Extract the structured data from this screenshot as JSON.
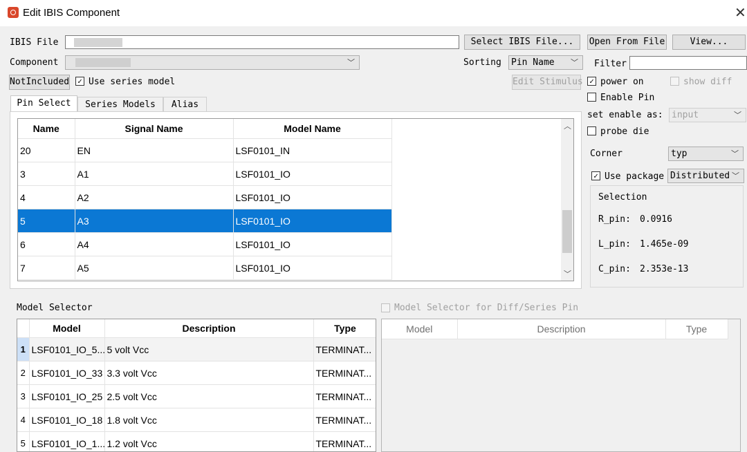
{
  "window": {
    "title": "Edit IBIS Component",
    "close_glyph": "✕"
  },
  "ibis_file": {
    "label": "IBIS File",
    "value": "",
    "select_button": "Select IBIS File...",
    "open_button": "Open From File",
    "view_button": "View..."
  },
  "component": {
    "label": "Component",
    "value": ""
  },
  "sorting": {
    "label": "Sorting",
    "value": "Pin Name"
  },
  "filter": {
    "label": "Filter",
    "value": ""
  },
  "not_included_button": "NotIncluded",
  "use_series_model": {
    "label": "Use series model",
    "checked": true
  },
  "edit_stimulus_button": "Edit Stimulus",
  "power_on": {
    "label": "power on",
    "checked": true
  },
  "show_diff": {
    "label": "show diff",
    "checked": false
  },
  "enable_pin": {
    "label": "Enable Pin",
    "checked": false
  },
  "set_enable_as": {
    "label": "set enable as:",
    "value": "input"
  },
  "probe_die": {
    "label": "probe die",
    "checked": false
  },
  "corner": {
    "label": "Corner",
    "value": "typ"
  },
  "use_package": {
    "label": "Use package",
    "checked": true,
    "value": "Distributed"
  },
  "selection": {
    "title": "Selection",
    "r_pin": {
      "label": "R_pin:",
      "value": "0.0916"
    },
    "l_pin": {
      "label": "L_pin:",
      "value": "1.465e-09"
    },
    "c_pin": {
      "label": "C_pin:",
      "value": "2.353e-13"
    }
  },
  "tabs": [
    "Pin Select",
    "Series Models",
    "Alias"
  ],
  "pin_table": {
    "columns": [
      "Name",
      "Signal Name",
      "Model Name"
    ],
    "rows": [
      {
        "name": "20",
        "signal": "EN",
        "model": "LSF0101_IN"
      },
      {
        "name": "3",
        "signal": "A1",
        "model": "LSF0101_IO"
      },
      {
        "name": "4",
        "signal": "A2",
        "model": "LSF0101_IO"
      },
      {
        "name": "5",
        "signal": "A3",
        "model": "LSF0101_IO",
        "selected": true
      },
      {
        "name": "6",
        "signal": "A4",
        "model": "LSF0101_IO"
      },
      {
        "name": "7",
        "signal": "A5",
        "model": "LSF0101_IO"
      }
    ]
  },
  "model_selector": {
    "label": "Model Selector",
    "columns": [
      "Model",
      "Description",
      "Type"
    ],
    "rows": [
      {
        "n": "1",
        "model": "LSF0101_IO_5...",
        "description": "5 volt Vcc",
        "type": "TERMINAT..."
      },
      {
        "n": "2",
        "model": "LSF0101_IO_33",
        "description": "3.3 volt Vcc",
        "type": "TERMINAT..."
      },
      {
        "n": "3",
        "model": "LSF0101_IO_25",
        "description": "2.5 volt Vcc",
        "type": "TERMINAT..."
      },
      {
        "n": "4",
        "model": "LSF0101_IO_18",
        "description": "1.8 volt Vcc",
        "type": "TERMINAT..."
      },
      {
        "n": "5",
        "model": "LSF0101_IO_1...",
        "description": "1.2 volt Vcc",
        "type": "TERMINAT..."
      }
    ]
  },
  "diff_selector": {
    "label": "Model Selector for Diff/Series Pin",
    "checked": false,
    "columns": [
      "Model",
      "Description",
      "Type"
    ]
  }
}
